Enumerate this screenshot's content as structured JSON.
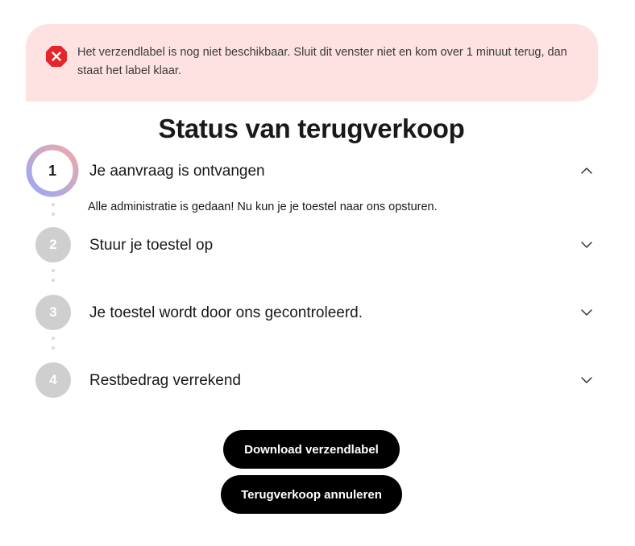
{
  "alert": {
    "message": "Het verzendlabel is nog niet beschikbaar. Sluit dit venster niet en kom over 1 minuut terug, dan staat het label klaar.",
    "icon": "error-close-icon",
    "background_color": "#fde2e1",
    "icon_color": "#e3262b"
  },
  "page": {
    "title": "Status van terugverkoop"
  },
  "steps": [
    {
      "number": "1",
      "label": "Je aanvraag is ontvangen",
      "expanded": true,
      "description": "Alle administratie is gedaan! Nu kun je je toestel naar ons opsturen.",
      "chevron": "chevron-up-icon"
    },
    {
      "number": "2",
      "label": "Stuur je toestel op",
      "expanded": false,
      "chevron": "chevron-down-icon"
    },
    {
      "number": "3",
      "label": "Je toestel wordt door ons gecontroleerd.",
      "expanded": false,
      "chevron": "chevron-down-icon"
    },
    {
      "number": "4",
      "label": "Restbedrag verrekend",
      "expanded": false,
      "chevron": "chevron-down-icon"
    }
  ],
  "actions": {
    "download_label": "Download verzendlabel",
    "cancel_label": "Terugverkoop annuleren"
  },
  "colors": {
    "accent_gradient_start": "#f0a8a8",
    "accent_gradient_end": "#9aa8f5",
    "inactive_step": "#cfcfcf",
    "button": "#000000"
  }
}
